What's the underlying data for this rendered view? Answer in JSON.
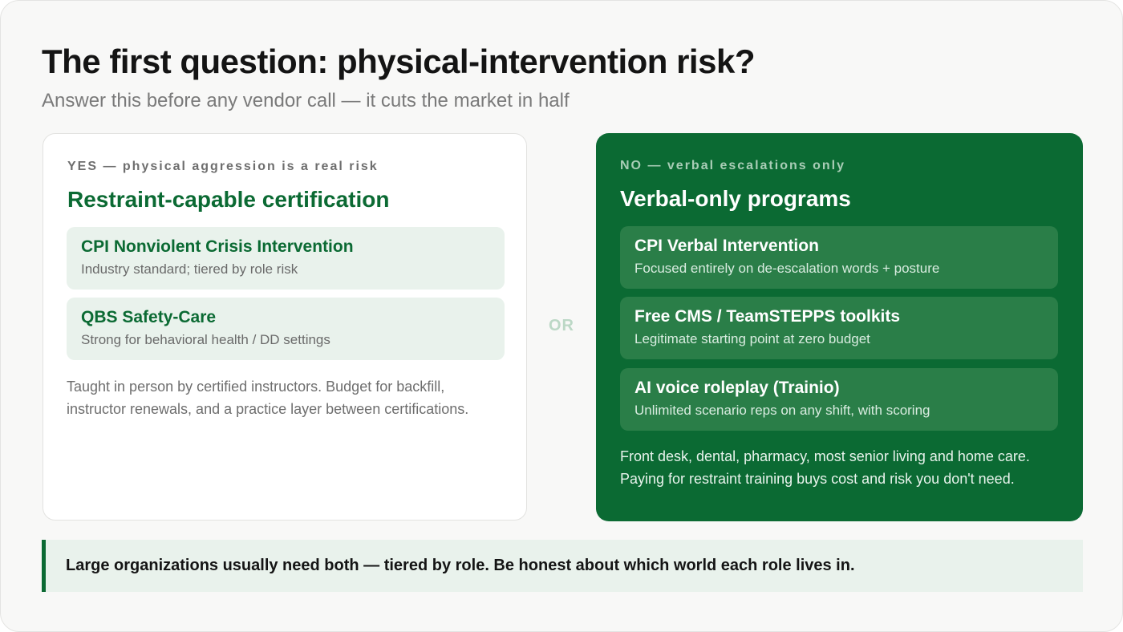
{
  "header": {
    "title": "The first question: physical-intervention risk?",
    "subtitle": "Answer this before any vendor call — it cuts the market in half"
  },
  "left_card": {
    "eyebrow": "YES — physical aggression is a real risk",
    "title": "Restraint-capable certification",
    "options": [
      {
        "name": "CPI Nonviolent Crisis Intervention",
        "desc": "Industry standard; tiered by role risk"
      },
      {
        "name": "QBS Safety-Care",
        "desc": "Strong for behavioral health / DD settings"
      }
    ],
    "note": "Taught in person by certified instructors. Budget for backfill, instructor renewals, and a practice layer between certifications."
  },
  "divider": {
    "label": "OR"
  },
  "right_card": {
    "eyebrow": "NO — verbal escalations only",
    "title": "Verbal-only programs",
    "options": [
      {
        "name": "CPI Verbal Intervention",
        "desc": "Focused entirely on de-escalation words + posture"
      },
      {
        "name": "Free CMS / TeamSTEPPS toolkits",
        "desc": "Legitimate starting point at zero budget"
      },
      {
        "name": "AI voice roleplay (Trainio)",
        "desc": "Unlimited scenario reps on any shift, with scoring"
      }
    ],
    "note": "Front desk, dental, pharmacy, most senior living and home care. Paying for restraint training buys cost and risk you don't need."
  },
  "callout": {
    "text": "Large organizations usually need both — tiered by role. Be honest about which world each role lives in."
  },
  "colors": {
    "brand_green": "#0b6a33",
    "light_green": "#e9f2ec",
    "option_green": "#2a7e48"
  }
}
